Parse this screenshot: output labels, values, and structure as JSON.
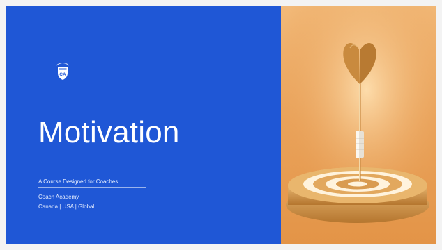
{
  "slide": {
    "title": "Motivation",
    "subtitle": "A Course Designed for Coaches",
    "organization": "Coach Academy",
    "locations": "Canada | USA | Global",
    "logo_monogram": "CA",
    "left_panel_color": "#1f57d6",
    "right_panel_color": "#eaa35b"
  },
  "image": {
    "icon": "dart-target-icon"
  }
}
